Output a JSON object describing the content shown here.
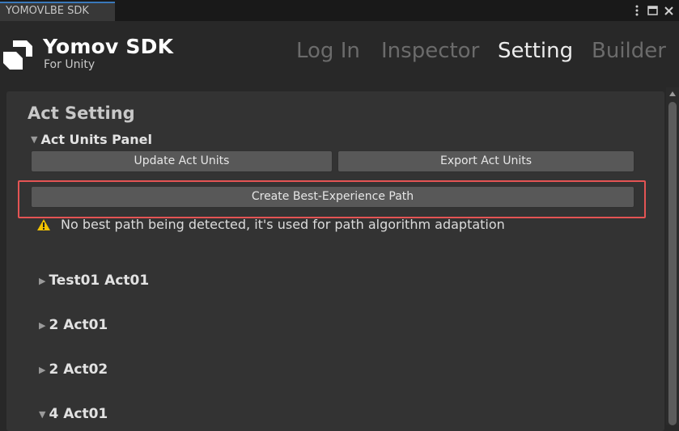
{
  "window": {
    "tab_title": "YOMOVLBE SDK"
  },
  "brand": {
    "title": "Yomov SDK",
    "subtitle": "For Unity"
  },
  "nav": {
    "items": [
      {
        "label": "Log In",
        "active": false
      },
      {
        "label": "Inspector",
        "active": false
      },
      {
        "label": "Setting",
        "active": true
      },
      {
        "label": "Builder",
        "active": false
      }
    ]
  },
  "content": {
    "section_title": "Act Setting",
    "panel": {
      "label": "Act Units Panel",
      "expanded": true
    },
    "buttons": {
      "update": "Update Act Units",
      "export": "Export Act Units",
      "create_path": "Create Best-Experience Path"
    },
    "warning_text": "No best path being detected, it's used for path algorithm adaptation",
    "acts": [
      {
        "label": "Test01 Act01",
        "expanded": false
      },
      {
        "label": "2 Act01",
        "expanded": false
      },
      {
        "label": "2 Act02",
        "expanded": false
      },
      {
        "label": "4 Act01",
        "expanded": true
      }
    ]
  },
  "colors": {
    "accent_tab": "#3a79bb",
    "highlight": "#e45454",
    "warning": "#f2c200"
  },
  "icons": {
    "menu": "kebab-icon",
    "maximize": "maximize-icon",
    "close": "close-icon",
    "warning": "warning-icon",
    "logo": "logo-icon"
  }
}
